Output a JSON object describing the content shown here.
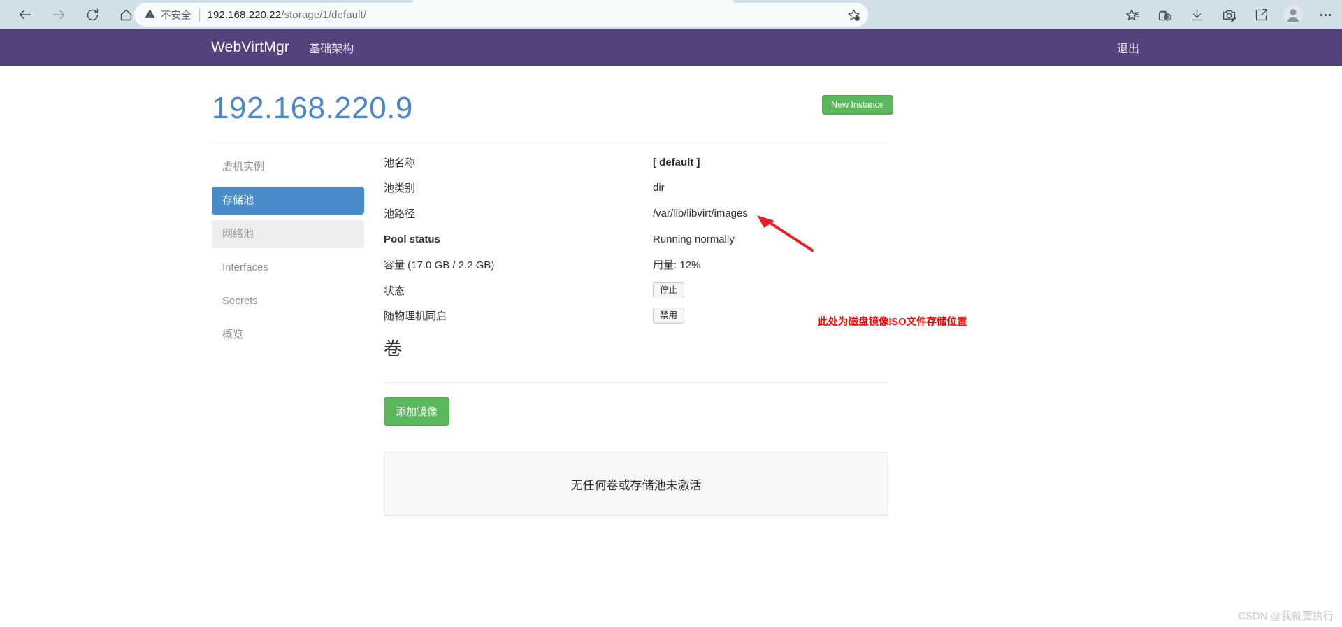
{
  "browser": {
    "back_icon": "back-arrow-icon",
    "forward_icon": "forward-arrow-icon",
    "reload_icon": "reload-icon",
    "home_icon": "home-icon",
    "security_label": "不安全",
    "url": "192.168.220.22/storage/1/default/",
    "url_host": "192.168.220.22",
    "url_path": "/storage/1/default/",
    "favorite_icon": "add-favorite-star-icon",
    "right_icons": [
      "favorites-list-icon",
      "collections-add-icon",
      "downloads-icon",
      "screenshot-icon",
      "share-icon",
      "profile-avatar-icon",
      "more-options-icon"
    ]
  },
  "navbar": {
    "brand": "WebVirtMgr",
    "infrastructure_label": "基础架构",
    "logout_label": "退出",
    "bg_color": "#55417c"
  },
  "page": {
    "title": "192.168.220.9",
    "title_color": "#4a87c7",
    "new_instance_label": "New Instance",
    "new_instance_color": "#5bb75b"
  },
  "sidebar": {
    "items": [
      {
        "label": "虚机实例",
        "state": "plain"
      },
      {
        "label": "存储池",
        "state": "active"
      },
      {
        "label": "网络池",
        "state": "hover"
      },
      {
        "label": "Interfaces",
        "state": "plain"
      },
      {
        "label": "Secrets",
        "state": "plain"
      },
      {
        "label": "概览",
        "state": "plain"
      }
    ],
    "active_color": "#4a8bc9",
    "hover_color": "#eeeeee"
  },
  "details": {
    "rows": [
      {
        "label": "池名称",
        "value": "[ default ]",
        "label_bold": false,
        "value_bold": true,
        "type": "text"
      },
      {
        "label": "池类别",
        "value": "dir",
        "label_bold": false,
        "value_bold": false,
        "type": "text"
      },
      {
        "label": "池路径",
        "value": "/var/lib/libvirt/images",
        "label_bold": false,
        "value_bold": false,
        "type": "text"
      },
      {
        "label": "Pool status",
        "value": "Running normally",
        "label_bold": true,
        "value_bold": false,
        "type": "text"
      },
      {
        "label": "容量 (17.0 GB / 2.2 GB)",
        "value": "用量: 12%",
        "label_bold": false,
        "value_bold": false,
        "type": "text"
      },
      {
        "label": "状态",
        "value": "停止",
        "label_bold": false,
        "value_bold": false,
        "type": "button"
      },
      {
        "label": "随物理机同启",
        "value": "禁用",
        "label_bold": false,
        "value_bold": false,
        "type": "button"
      }
    ]
  },
  "volumes": {
    "heading": "卷",
    "add_image_label": "添加镜像",
    "empty_message": "无任何卷或存储池未激活"
  },
  "annotation": {
    "text": "此处为磁盘镜像ISO文件存储位置",
    "color": "#ff0000",
    "arrow_icon": "red-arrow-icon"
  },
  "watermark": "CSDN @我就要执行"
}
